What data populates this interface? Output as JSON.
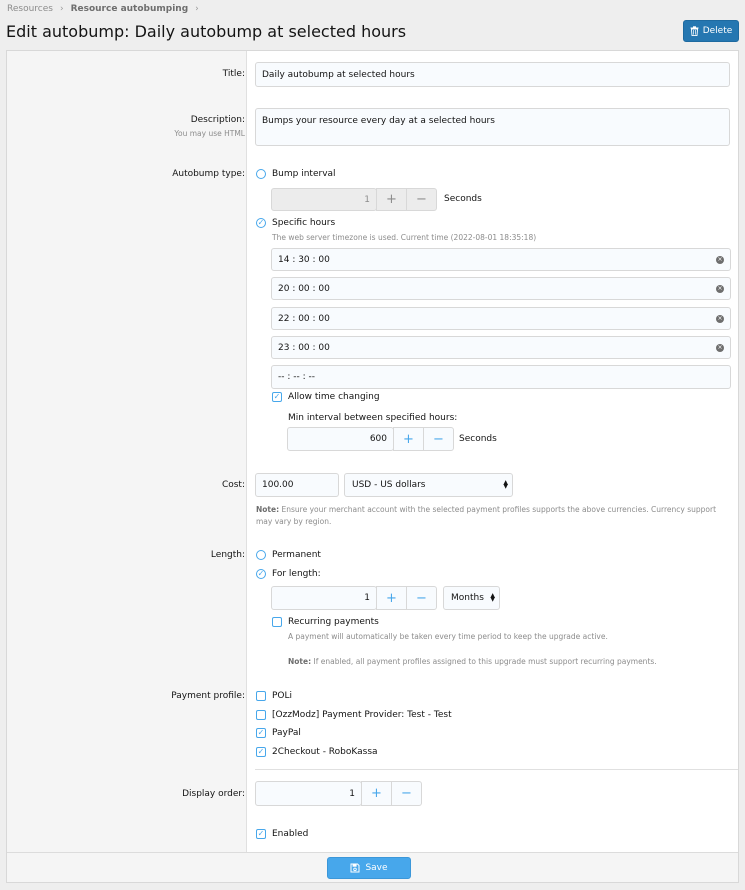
{
  "breadcrumb": {
    "root": "Resources",
    "current": "Resource autobumping"
  },
  "page": {
    "title": "Edit autobump: Daily autobump at selected hours",
    "delete_label": "Delete"
  },
  "form": {
    "title": {
      "label": "Title:",
      "value": "Daily autobump at selected hours"
    },
    "description": {
      "label": "Description:",
      "hint": "You may use HTML",
      "value": "Bumps your resource every day at a selected hours"
    },
    "autobump_type": {
      "label": "Autobump type:",
      "interval_option": "Bump interval",
      "interval_value": "1",
      "interval_unit": "Seconds",
      "specific_option": "Specific hours",
      "specific_hint": "The web server timezone is used. Current time (2022-08-01 18:35:18)",
      "hours": [
        "14 : 30 : 00",
        "20 : 00 : 00",
        "22 : 00 : 00",
        "23 : 00 : 00"
      ],
      "empty_hour": "-- : -- : --",
      "allow_changing": "Allow time changing",
      "min_interval_label": "Min interval between specified hours:",
      "min_interval_value": "600",
      "min_interval_unit": "Seconds"
    },
    "cost": {
      "label": "Cost:",
      "value": "100.00",
      "currency": "USD - US dollars",
      "note_bold": "Note:",
      "note_line1": "Ensure your merchant account with the selected payment profiles supports the above currencies. Currency support",
      "note_line2": "may vary by region."
    },
    "length": {
      "label": "Length:",
      "permanent": "Permanent",
      "for_length": "For length:",
      "value": "1",
      "unit": "Months",
      "recurring": "Recurring payments",
      "recurring_hint": "A payment will automatically be taken every time period to keep the upgrade active.",
      "note_bold": "Note:",
      "note_text": "If enabled, all payment profiles assigned to this upgrade must support recurring payments."
    },
    "payment_profile": {
      "label": "Payment profile:",
      "options": [
        {
          "name": "POLi",
          "checked": false
        },
        {
          "name": "[OzzModz] Payment Provider: Test - Test",
          "checked": false
        },
        {
          "name": "PayPal",
          "checked": true
        },
        {
          "name": "2Checkout - RoboKassa",
          "checked": true
        }
      ]
    },
    "display_order": {
      "label": "Display order:",
      "value": "1"
    },
    "enabled": {
      "label": "Enabled"
    }
  },
  "footer": {
    "save_label": "Save"
  },
  "icons": {
    "plus": "+",
    "minus": "−",
    "check": "✓",
    "clear": "×"
  },
  "colors": {
    "accent": "#47a7eb",
    "delete_btn": "#2577b1",
    "save_btn": "#47a7eb"
  }
}
